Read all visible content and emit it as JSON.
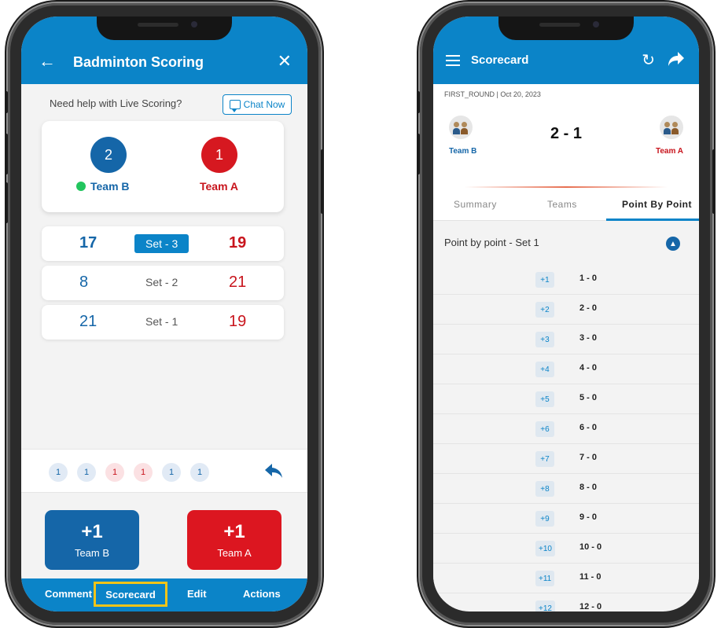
{
  "left_app": {
    "header": {
      "title": "Badminton Scoring",
      "back_icon": "arrow-left-icon",
      "close_icon": "close-icon"
    },
    "help": {
      "text": "Need help with Live Scoring?",
      "chat_label": "Chat Now"
    },
    "scoreboard": {
      "team_b": {
        "name": "Team B",
        "sets_won": "2",
        "serving": true
      },
      "team_a": {
        "name": "Team A",
        "sets_won": "1"
      }
    },
    "sets": [
      {
        "label": "Set - 3",
        "team_b": "17",
        "team_a": "19",
        "active": true
      },
      {
        "label": "Set - 2",
        "team_b": "8",
        "team_a": "21",
        "active": false
      },
      {
        "label": "Set - 1",
        "team_b": "21",
        "team_a": "19",
        "active": false
      }
    ],
    "rally_history": [
      {
        "value": "1",
        "team": "b"
      },
      {
        "value": "1",
        "team": "b"
      },
      {
        "value": "1",
        "team": "a"
      },
      {
        "value": "1",
        "team": "a"
      },
      {
        "value": "1",
        "team": "b"
      },
      {
        "value": "1",
        "team": "b"
      }
    ],
    "point_buttons": {
      "team_b": {
        "plus": "+1",
        "name": "Team B"
      },
      "team_a": {
        "plus": "+1",
        "name": "Team A"
      }
    },
    "bottom_tabs": {
      "comment": "Comment",
      "scorecard": "Scorecard",
      "edit": "Edit",
      "actions": "Actions"
    }
  },
  "right_app": {
    "header": {
      "title": "Scorecard",
      "refresh_glyph": "↻"
    },
    "match_meta": "FIRST_ROUND | Oct 20, 2023",
    "team_b_name": "Team B",
    "team_a_name": "Team A",
    "score": "2 - 1",
    "tabs": {
      "summary": "Summary",
      "teams": "Teams",
      "point_by_point": "Point By Point"
    },
    "pbp_heading": "Point by point - Set 1",
    "points": [
      {
        "badge": "+1",
        "score": "1 - 0"
      },
      {
        "badge": "+2",
        "score": "2 - 0"
      },
      {
        "badge": "+3",
        "score": "3 - 0"
      },
      {
        "badge": "+4",
        "score": "4 - 0"
      },
      {
        "badge": "+5",
        "score": "5 - 0"
      },
      {
        "badge": "+6",
        "score": "6 - 0"
      },
      {
        "badge": "+7",
        "score": "7 - 0"
      },
      {
        "badge": "+8",
        "score": "8 - 0"
      },
      {
        "badge": "+9",
        "score": "9 - 0"
      },
      {
        "badge": "+10",
        "score": "10 - 0"
      },
      {
        "badge": "+11",
        "score": "11 - 0"
      },
      {
        "badge": "+12",
        "score": "12 - 0"
      }
    ]
  },
  "colors": {
    "primary": "#0b84c8",
    "team_b": "#1566a8",
    "team_a": "#d61820",
    "serve_indicator": "#22c55e",
    "highlight": "#f0c419"
  }
}
